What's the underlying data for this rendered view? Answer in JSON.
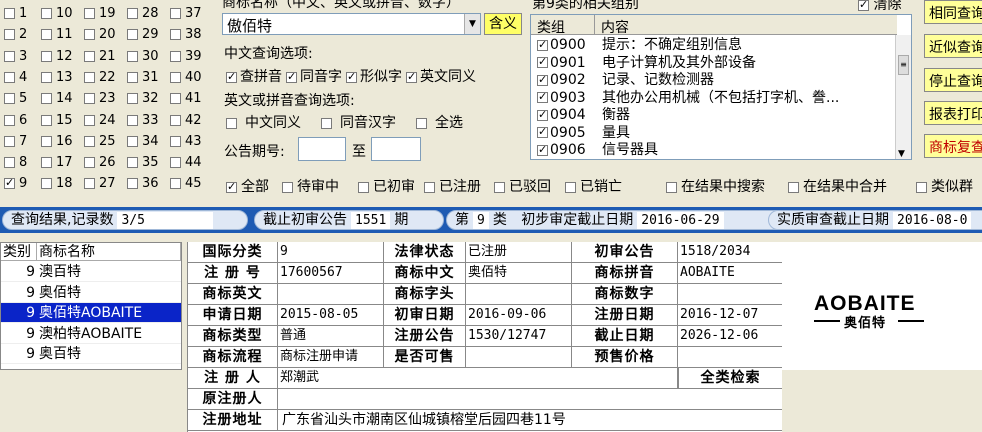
{
  "number_grid": {
    "cols": [
      [
        {
          "n": "1",
          "on": false
        },
        {
          "n": "2",
          "on": false
        },
        {
          "n": "3",
          "on": false
        },
        {
          "n": "4",
          "on": false
        },
        {
          "n": "5",
          "on": false
        },
        {
          "n": "6",
          "on": false
        },
        {
          "n": "7",
          "on": false
        },
        {
          "n": "8",
          "on": false
        },
        {
          "n": "9",
          "on": true
        }
      ],
      [
        {
          "n": "10",
          "on": false
        },
        {
          "n": "11",
          "on": false
        },
        {
          "n": "12",
          "on": false
        },
        {
          "n": "13",
          "on": false
        },
        {
          "n": "14",
          "on": false
        },
        {
          "n": "15",
          "on": false
        },
        {
          "n": "16",
          "on": false
        },
        {
          "n": "17",
          "on": false
        },
        {
          "n": "18",
          "on": false
        }
      ],
      [
        {
          "n": "19",
          "on": false
        },
        {
          "n": "20",
          "on": false
        },
        {
          "n": "21",
          "on": false
        },
        {
          "n": "22",
          "on": false
        },
        {
          "n": "23",
          "on": false
        },
        {
          "n": "24",
          "on": false
        },
        {
          "n": "25",
          "on": false
        },
        {
          "n": "26",
          "on": false
        },
        {
          "n": "27",
          "on": false
        }
      ],
      [
        {
          "n": "28",
          "on": false
        },
        {
          "n": "29",
          "on": false
        },
        {
          "n": "30",
          "on": false
        },
        {
          "n": "31",
          "on": false
        },
        {
          "n": "32",
          "on": false
        },
        {
          "n": "33",
          "on": false
        },
        {
          "n": "34",
          "on": false
        },
        {
          "n": "35",
          "on": false
        },
        {
          "n": "36",
          "on": false
        }
      ],
      [
        {
          "n": "37",
          "on": false
        },
        {
          "n": "38",
          "on": false
        },
        {
          "n": "39",
          "on": false
        },
        {
          "n": "40",
          "on": false
        },
        {
          "n": "41",
          "on": false
        },
        {
          "n": "42",
          "on": false
        },
        {
          "n": "43",
          "on": false
        },
        {
          "n": "44",
          "on": false
        },
        {
          "n": "45",
          "on": false
        }
      ]
    ]
  },
  "search": {
    "name_label": "商标名称（中文、英文或拼音、数字）",
    "name_value": "傲佰特",
    "meaning_button": "含义",
    "cn_options_label": "中文查询选项:",
    "cn_options": [
      {
        "label": "查拼音",
        "on": true
      },
      {
        "label": "同音字",
        "on": true
      },
      {
        "label": "形似字",
        "on": true
      },
      {
        "label": "英文同义",
        "on": true
      }
    ],
    "en_options_label": "英文或拼音查询选项:",
    "en_options": [
      {
        "label": "中文同义",
        "on": false
      },
      {
        "label": "同音汉字",
        "on": false
      },
      {
        "label": "全选",
        "on": false
      }
    ],
    "gazette_label": "公告期号:",
    "to_label": "至",
    "gazette_from": "",
    "gazette_to": ""
  },
  "groups": {
    "title": "第9类的相关组别",
    "clear_label": "清除",
    "clear_on": true,
    "col_group": "类组",
    "col_content": "内容",
    "rows": [
      {
        "code": "0900",
        "text": "提示：不确定组别信息",
        "on": true
      },
      {
        "code": "0901",
        "text": "电子计算机及其外部设备",
        "on": true
      },
      {
        "code": "0902",
        "text": "记录、记数检测器",
        "on": true
      },
      {
        "code": "0903",
        "text": "其他办公用机械（不包括打字机、誊...",
        "on": true
      },
      {
        "code": "0904",
        "text": "衡器",
        "on": true
      },
      {
        "code": "0905",
        "text": "量具",
        "on": true
      },
      {
        "code": "0906",
        "text": "信号器具",
        "on": true
      }
    ]
  },
  "buttons": {
    "same_query": "相同查询",
    "approx_query": "近似查询",
    "stop_query": "停止查询",
    "report_print": "报表打印",
    "review": "商标复查"
  },
  "filters": [
    {
      "label": "全部",
      "on": true
    },
    {
      "label": "待审中",
      "on": false
    },
    {
      "label": "已初审",
      "on": false
    },
    {
      "label": "已注册",
      "on": false
    },
    {
      "label": "已驳回",
      "on": false
    },
    {
      "label": "已销亡",
      "on": false
    },
    {
      "label": "在结果中搜索",
      "on": false
    },
    {
      "label": "在结果中合并",
      "on": false
    },
    {
      "label": "类似群",
      "on": false
    }
  ],
  "status": {
    "result_label": "查询结果,记录数",
    "result_count": "3/5",
    "deadline_label": "截止初审公告",
    "deadline_value": "1551",
    "deadline_unit": "期",
    "class_prefix": "第",
    "class_value": "9",
    "class_suffix": "类",
    "prelim_label": "初步审定截止日期",
    "prelim_date": "2016-06-29",
    "exam_label": "实质审查截止日期",
    "exam_date": "2016-08-0"
  },
  "tm_list": {
    "col_class": "类别",
    "col_name": "商标名称",
    "rows": [
      {
        "cls": "9",
        "name": "澳百特",
        "sel": false
      },
      {
        "cls": "9",
        "name": "奥佰特",
        "sel": false
      },
      {
        "cls": "9",
        "name": "奥佰特AOBAITE",
        "sel": true
      },
      {
        "cls": "9",
        "name": "澳柏特AOBAITE",
        "sel": false
      },
      {
        "cls": "9",
        "name": "奥百特",
        "sel": false
      }
    ]
  },
  "detail": {
    "intl_class_label": "国际分类",
    "intl_class": "9",
    "legal_status_label": "法律状态",
    "legal_status": "已注册",
    "prelim_gazette_label": "初审公告",
    "prelim_gazette": "1518/2034",
    "reg_no_label": "注 册 号",
    "reg_no": "17600567",
    "cn_name_label": "商标中文",
    "cn_name": "奥佰特",
    "pinyin_label": "商标拼音",
    "pinyin": "AOBAITE",
    "en_name_label": "商标英文",
    "en_name": "",
    "head_char_label": "商标字头",
    "head_char": "",
    "digits_label": "商标数字",
    "digits": "",
    "apply_date_label": "申请日期",
    "apply_date": "2015-08-05",
    "prelim_date_label": "初审日期",
    "prelim_date": "2016-09-06",
    "reg_date_label": "注册日期",
    "reg_date": "2016-12-07",
    "type_label": "商标类型",
    "type": "普通",
    "reg_gazette_label": "注册公告",
    "reg_gazette": "1530/12747",
    "expire_label": "截止日期",
    "expire": "2026-12-06",
    "flow_label": "商标流程",
    "flow": "商标注册申请",
    "for_sale_label": "是否可售",
    "for_sale": "",
    "presale_label": "预售价格",
    "presale": "",
    "registrant_label": "注 册 人",
    "registrant": "郑潮武",
    "full_search": "全类检索",
    "orig_registrant_label": "原注册人",
    "orig_registrant": "",
    "address_label": "注册地址",
    "address": "广东省汕头市潮南区仙城镇榕堂后园四巷11号"
  },
  "logo": {
    "en": "AOBAITE",
    "cn": "奥佰特"
  }
}
